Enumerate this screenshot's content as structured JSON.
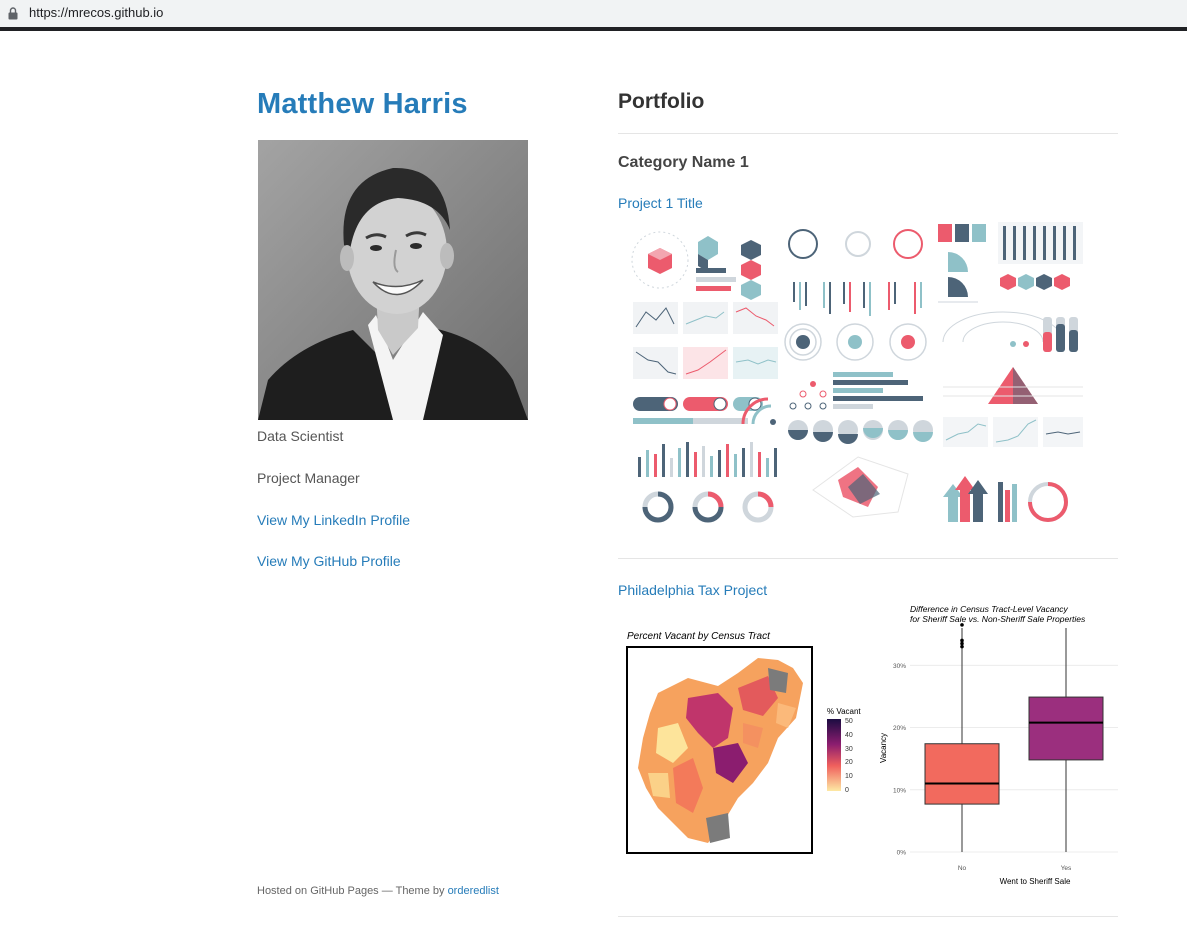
{
  "browser": {
    "url": "https://mrecos.github.io"
  },
  "profile": {
    "name": "Matthew Harris",
    "roles": [
      "Data Scientist",
      "Project Manager"
    ],
    "links": [
      "View My LinkedIn Profile",
      "View My GitHub Profile"
    ]
  },
  "footer": {
    "text": "Hosted on GitHub Pages — Theme by ",
    "link": "orderedlist"
  },
  "portfolio": {
    "heading": "Portfolio",
    "category": "Category Name 1",
    "projects": [
      {
        "title": "Project 1 Title"
      },
      {
        "title": "Philadelphia Tax Project"
      }
    ]
  },
  "map_figure": {
    "title": "Percent Vacant by Census Tract",
    "legend_title": "% Vacant",
    "legend_ticks": [
      "50",
      "40",
      "30",
      "20",
      "10",
      "0"
    ]
  },
  "chart_data": {
    "type": "box",
    "title": "Difference in Census Tract-Level Vacancy\nfor Sheriff Sale vs. Non-Sheriff Sale Properties",
    "title_lines": [
      "Difference in Census Tract-Level Vacancy",
      "for Sheriff Sale vs. Non-Sheriff Sale Properties"
    ],
    "xlabel": "Went to Sheriff Sale",
    "ylabel": "Vacancy",
    "categories": [
      "No",
      "Yes"
    ],
    "yticks": [
      "0%",
      "10%",
      "20%",
      "30%"
    ],
    "ylim": [
      0,
      0.36
    ],
    "boxes": [
      {
        "name": "No",
        "whisker_low": 0.0,
        "q1": 0.077,
        "median": 0.11,
        "q3": 0.174,
        "whisker_high": 0.36,
        "outliers": [
          0.33,
          0.335,
          0.34,
          0.365
        ],
        "color": "#f26a5e"
      },
      {
        "name": "Yes",
        "whisker_low": 0.0,
        "q1": 0.148,
        "median": 0.208,
        "q3": 0.249,
        "whisker_high": 0.36,
        "outliers": [],
        "color": "#9b2f7e"
      }
    ]
  },
  "colors": {
    "link": "#267cb9",
    "heading": "#333333",
    "accent_red": "#ec5b6d",
    "accent_slate": "#4d6478",
    "accent_teal": "#8fc1c8"
  }
}
